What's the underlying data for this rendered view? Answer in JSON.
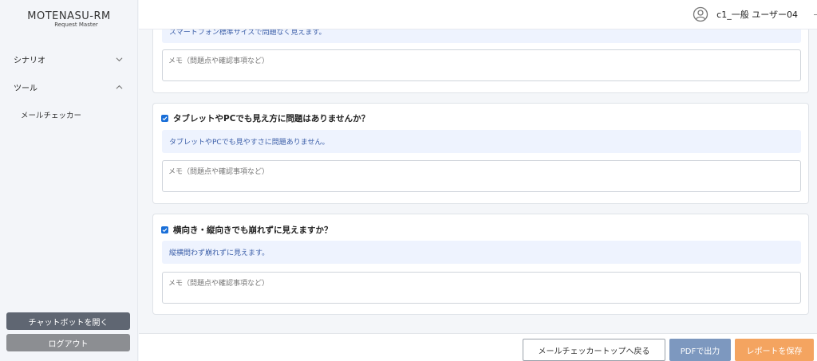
{
  "brand": {
    "title": "MOTENASU-RM",
    "subtitle": "Request Master"
  },
  "sidebar": {
    "items": [
      {
        "label": "シナリオ",
        "expanded": false
      },
      {
        "label": "ツール",
        "expanded": true
      }
    ],
    "sub_items": [
      {
        "label": "メールチェッカー"
      }
    ],
    "chat_button": "チャットボットを開く",
    "logout_button": "ログアウト"
  },
  "header": {
    "user_name": "c1_一般 ユーザー04"
  },
  "cards": [
    {
      "answer": "スマートフォン標準サイズで問題なく見えます。",
      "memo_placeholder": "メモ（問題点や確認事項など）"
    },
    {
      "question": "タブレットやPCでも見え方に問題はありませんか？",
      "checked": true,
      "answer": "タブレットやPCでも見やすさに問題ありません。",
      "memo_placeholder": "メモ（問題点や確認事項など）"
    },
    {
      "question": "横向き・縦向きでも崩れずに見えますか？",
      "checked": true,
      "answer": "縦横問わず崩れずに見えます。",
      "memo_placeholder": "メモ（問題点や確認事項など）"
    }
  ],
  "footer": {
    "back_button": "メールチェッカートップへ戻る",
    "pdf_button": "PDFで出力",
    "save_button": "レポートを保存"
  },
  "colors": {
    "checkbox": "#1a6fd8",
    "answer_bg": "#eef3fe",
    "answer_text": "#3b5ea8",
    "pdf_button": "#7d98bf",
    "save_button": "#f4a460",
    "chat_button": "#5f6672",
    "logout_button": "#8c8e92"
  }
}
